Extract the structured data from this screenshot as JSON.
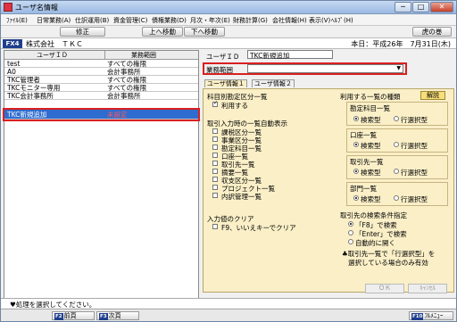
{
  "window": {
    "title": "ユーザ名情報",
    "close_glyph": "✕",
    "min_glyph": "─",
    "max_glyph": "□"
  },
  "menu": [
    "ﾌｧｲﾙ(E)",
    "日常業務(A)",
    "仕訳運用(B)",
    "資金管理(C)",
    "債権業務(D)",
    "月次・年次(E)",
    "財務計算(G)",
    "会社情報(H)",
    "表示(V)",
    "ﾍﾙﾌﾟ(H)"
  ],
  "toolbar": {
    "fix": "修正",
    "up": "上へ移動",
    "down": "下へ移動",
    "volume": "虎の巻"
  },
  "corp": {
    "badge": "FX4",
    "name": "株式会社　ＴＫＣ",
    "date": "本日：平成26年　7月31日(木)"
  },
  "list": {
    "headers": [
      "ユーザＩＤ",
      "業務範囲"
    ],
    "rows": [
      {
        "id": "test",
        "scope": "すべての権限"
      },
      {
        "id": "A0",
        "scope": "会計事務所"
      },
      {
        "id": "TKC管理者",
        "scope": "すべての権限"
      },
      {
        "id": "TKCモニター専用",
        "scope": "すべての権限"
      },
      {
        "id": "TKC会計事務所",
        "scope": "会計事務所"
      },
      {
        "id": "TKC新規追加",
        "scope": "未設定"
      }
    ]
  },
  "detail": {
    "user_id_label": "ユーザＩＤ",
    "user_id_value": "TKC新規追加",
    "scope_label": "業務範囲",
    "scope_value": "",
    "tabs": [
      "ユーザ情報１",
      "ユーザ情報２"
    ]
  },
  "panel": {
    "sec1": "科目別勘定区分一覧",
    "use": "利用する",
    "sec2": "取引入力時の一覧自動表示",
    "checks": [
      "課税区分一覧",
      "事業区分一覧",
      "勘定科目一覧",
      "口座一覧",
      "取引先一覧",
      "摘要一覧",
      "収支区分一覧",
      "プロジェクト一覧",
      "内訳管理一覧"
    ],
    "sec3": "入力値のクリア",
    "clear": "F9、いいえキーでクリア",
    "kinds_title": "利用する一覧の種類",
    "help": "解説",
    "groups": [
      {
        "title": "勘定科目一覧",
        "a": "検索型",
        "b": "行選択型"
      },
      {
        "title": "口座一覧",
        "a": "検索型",
        "b": "行選択型"
      },
      {
        "title": "取引先一覧",
        "a": "検索型",
        "b": "行選択型"
      },
      {
        "title": "部門一覧",
        "a": "検索型",
        "b": "行選択型"
      }
    ],
    "search_title": "取引先の検索条件指定",
    "search_opts": [
      "「F8」で検索",
      "「Enter」で検索",
      "自動的に開く"
    ],
    "note1": "♣取引先一覧で「行選択型」を",
    "note2": "選択している場合のみ有効",
    "ok": "ＯＫ",
    "cancel": "ｷｬﾝｾﾙ"
  },
  "status": "♥処理を選択してください。",
  "fkeys": {
    "f2": "F2",
    "prev": "前頁",
    "f3": "F3",
    "next": "次頁",
    "f10": "F10",
    "menu": "ﾌﾙﾒﾆｭｰ"
  }
}
